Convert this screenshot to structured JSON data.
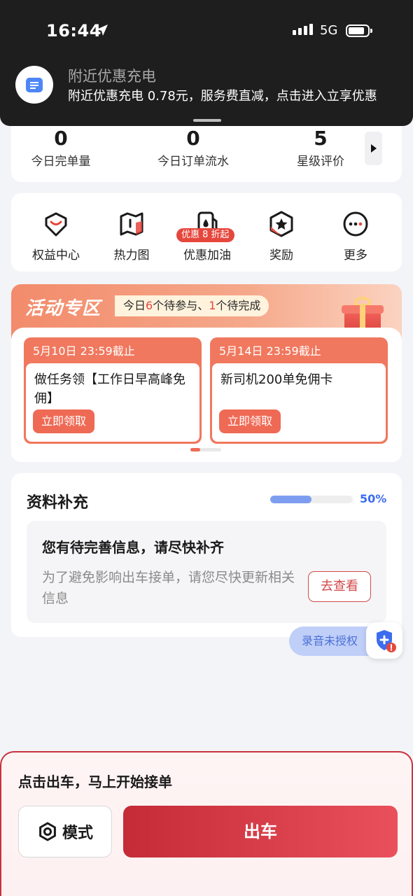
{
  "status_bar": {
    "time": "16:44",
    "network": "5G"
  },
  "notification": {
    "title": "附近优惠充电",
    "body": "附近优惠充电 0.78元，服务费直减，点击进入立享优惠"
  },
  "stats": [
    {
      "value": "0",
      "label": "今日完单量"
    },
    {
      "value": "0",
      "label": "今日订单流水"
    },
    {
      "value": "5",
      "label": "星级评价"
    }
  ],
  "tools": [
    {
      "label": "权益中心",
      "icon": "diamond-icon"
    },
    {
      "label": "热力图",
      "icon": "map-icon"
    },
    {
      "label": "优惠加油",
      "icon": "fuel-icon",
      "badge": "优惠 8 折起"
    },
    {
      "label": "奖励",
      "icon": "star-badge-icon"
    },
    {
      "label": "更多",
      "icon": "more-icon"
    }
  ],
  "activity": {
    "title": "活动专区",
    "subtitle_prefix": "今日",
    "pending_count": "6",
    "subtitle_mid": "个待参与、",
    "todo_count": "1",
    "subtitle_suffix": "个待完成",
    "tasks": [
      {
        "deadline": "5月10日 23:59截止",
        "name": "做任务领【工作日早高峰免佣】",
        "button": "立即领取"
      },
      {
        "deadline": "5月14日 23:59截止",
        "name": "新司机200单免佣卡",
        "button": "立即领取"
      }
    ],
    "carousel_index": 1,
    "carousel_total": 2
  },
  "profile": {
    "title": "资料补充",
    "progress_percent": 50,
    "progress_label": "50%",
    "notice_title": "您有待完善信息，请尽快补齐",
    "notice_desc": "为了避免影响出车接单，请您尽快更新相关信息",
    "button": "去查看"
  },
  "recording": {
    "label": "录音未授权"
  },
  "bottom": {
    "hint": "点击出车，马上开始接单",
    "mode_button": "模式",
    "go_button": "出车"
  },
  "colors": {
    "accent": "#e5473d",
    "primary_red": "#c42b37",
    "progress": "#7d9ef0"
  }
}
